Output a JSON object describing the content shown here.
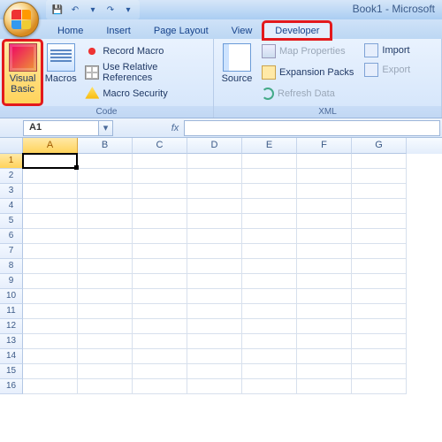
{
  "title": "Book1 - Microsoft",
  "qat": {
    "save": "💾",
    "undo": "↶",
    "redo": "↷",
    "dd": "▾"
  },
  "tabs": [
    "Home",
    "Insert",
    "Page Layout",
    "View",
    "Developer"
  ],
  "active_tab": 4,
  "ribbon": {
    "code": {
      "title": "Code",
      "visual_basic": "Visual Basic",
      "macros": "Macros",
      "record": "Record Macro",
      "relative": "Use Relative References",
      "security": "Macro Security"
    },
    "source": {
      "label": "Source"
    },
    "xml": {
      "title": "XML",
      "map": "Map Properties",
      "expansion": "Expansion Packs",
      "refresh": "Refresh Data",
      "import": "Import",
      "export": "Export"
    }
  },
  "namebox": "A1",
  "fx_label": "fx",
  "nb_arrow": "▾",
  "columns": [
    "A",
    "B",
    "C",
    "D",
    "E",
    "F",
    "G"
  ],
  "rows": [
    "1",
    "2",
    "3",
    "4",
    "5",
    "6",
    "7",
    "8",
    "9",
    "10",
    "11",
    "12",
    "13",
    "14",
    "15",
    "16"
  ],
  "active_cell": {
    "col": 0,
    "row": 0
  }
}
